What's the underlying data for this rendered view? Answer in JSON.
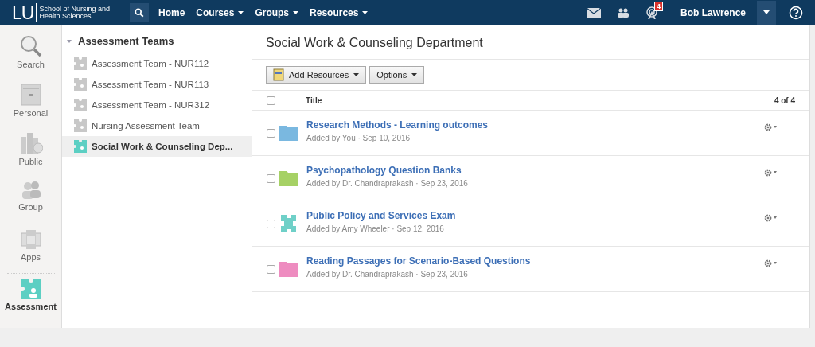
{
  "topbar": {
    "logo": "LU",
    "school": "School of Nursing and Health Sciences",
    "nav": [
      {
        "label": "Home",
        "dropdown": false
      },
      {
        "label": "Courses",
        "dropdown": true
      },
      {
        "label": "Groups",
        "dropdown": true
      },
      {
        "label": "Resources",
        "dropdown": true
      }
    ],
    "notification_count": "4",
    "user": "Bob Lawrence"
  },
  "rail": [
    {
      "label": "Search",
      "kind": "search",
      "selected": false
    },
    {
      "label": "Personal",
      "kind": "personal",
      "selected": false
    },
    {
      "label": "Public",
      "kind": "public",
      "selected": false
    },
    {
      "label": "Group",
      "kind": "group",
      "selected": false
    },
    {
      "label": "Apps",
      "kind": "apps",
      "selected": false
    },
    {
      "label": "Assessment",
      "kind": "assessment",
      "selected": true
    }
  ],
  "tree": {
    "title": "Assessment Teams",
    "expanded": true,
    "items": [
      {
        "label": "Assessment Team - NUR112",
        "selected": false
      },
      {
        "label": "Assessment Team - NUR113",
        "selected": false
      },
      {
        "label": "Assessment Team - NUR312",
        "selected": false
      },
      {
        "label": "Nursing Assessment Team",
        "selected": false
      },
      {
        "label": "Social Work & Counseling Dep...",
        "selected": true
      }
    ]
  },
  "main": {
    "title": "Social Work & Counseling Department",
    "buttons": [
      "Add Resources",
      "Options"
    ],
    "select_all_checked": false,
    "column": "Title",
    "count": "4 of 4",
    "rows": [
      {
        "title": "Research Methods - Learning outcomes",
        "meta": "Added by You · Sep 10, 2016",
        "kind": "folder",
        "color": "#7ab8e0",
        "checked": false
      },
      {
        "title": "Psychopathology Question Banks",
        "meta": "Added by Dr. Chandraprakash · Sep 23, 2016",
        "kind": "folder",
        "color": "#a6d165",
        "checked": false
      },
      {
        "title": "Public Policy and Services Exam",
        "meta": "Added by Amy Wheeler · Sep 12, 2016",
        "kind": "assessment",
        "color": "#6fd0c8",
        "checked": false
      },
      {
        "title": "Reading Passages for Scenario-Based Questions",
        "meta": "Added by Dr. Chandraprakash · Sep 23, 2016",
        "kind": "folder",
        "color": "#ee8cc0",
        "checked": false
      }
    ]
  }
}
